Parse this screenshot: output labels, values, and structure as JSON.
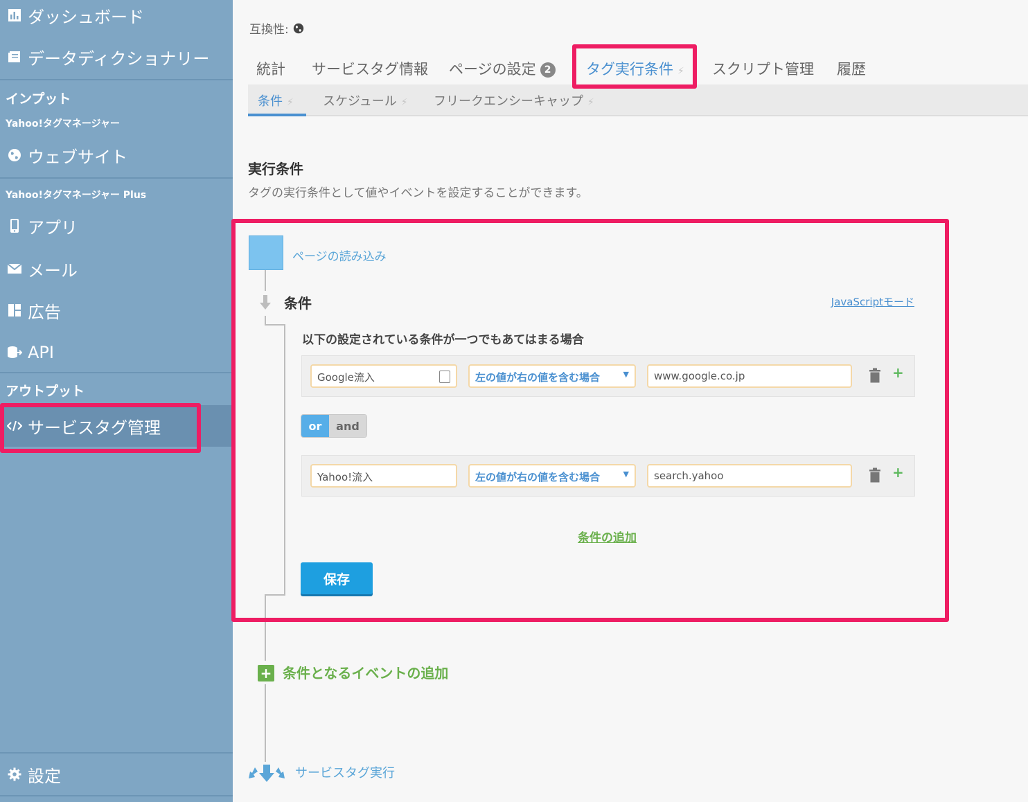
{
  "colors": {
    "sidebar_bg": "#7fa6c4",
    "accent_blue": "#4a90d0",
    "highlight_pink": "#ee1d63",
    "green": "#6ab04c",
    "save_blue": "#1e9fe0"
  },
  "sidebar": {
    "items_top": [
      {
        "label": "ダッシュボード",
        "icon": "bar-chart-icon"
      },
      {
        "label": "データディクショナリー",
        "icon": "book-icon"
      }
    ],
    "input_section": "インプット",
    "yahoo_tag_manager": "Yahoo!タグマネージャー",
    "website": {
      "label": "ウェブサイト",
      "icon": "globe-icon"
    },
    "yahoo_tag_manager_plus": "Yahoo!タグマネージャー Plus",
    "plus_items": [
      {
        "label": "アプリ",
        "icon": "phone-icon"
      },
      {
        "label": "メール",
        "icon": "mail-icon"
      },
      {
        "label": "広告",
        "icon": "layout-icon"
      },
      {
        "label": "API",
        "icon": "api-icon"
      }
    ],
    "output_section": "アウトプット",
    "service_tag": {
      "label": "サービスタグ管理",
      "icon": "code-icon"
    },
    "settings": {
      "label": "設定",
      "icon": "gear-icon"
    }
  },
  "main": {
    "compat_label": "互換性:",
    "tabs": [
      {
        "label": "統計"
      },
      {
        "label": "サービスタグ情報"
      },
      {
        "label": "ページの設定",
        "badge": "2"
      },
      {
        "label": "タグ実行条件"
      },
      {
        "label": "スクリプト管理"
      },
      {
        "label": "履歴"
      }
    ],
    "subtabs": [
      {
        "label": "条件"
      },
      {
        "label": "スケジュール"
      },
      {
        "label": "フリークエンシーキャップ"
      }
    ],
    "heading": "実行条件",
    "description": "タグの実行条件として値やイベントを設定することができます。",
    "page_load_label": "ページの読み込み",
    "condition_title": "条件",
    "js_mode_link": "JavaScriptモード",
    "condition_desc": "以下の設定されている条件が一つでもあてはまる場合",
    "conditions": [
      {
        "left": "Google流入",
        "operator": "左の値が右の値を含む場合",
        "right": "www.google.co.jp"
      },
      {
        "left": "Yahoo!流入",
        "operator": "左の値が右の値を含む場合",
        "right": "search.yahoo"
      }
    ],
    "toggle_or": "or",
    "toggle_and": "and",
    "add_condition": "条件の追加",
    "save": "保存",
    "add_event": "条件となるイベントの追加",
    "exec_label": "サービスタグ実行"
  }
}
